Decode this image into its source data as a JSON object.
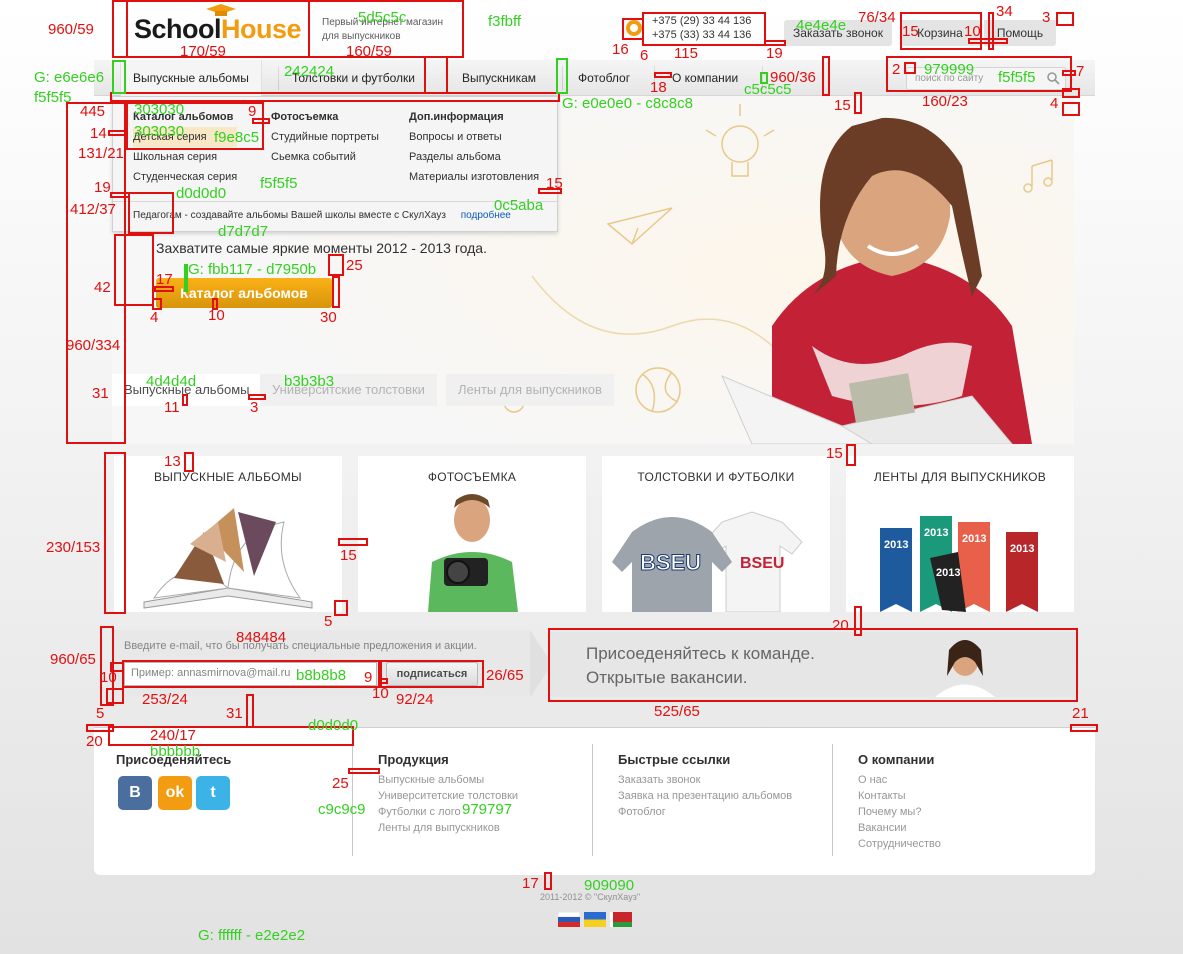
{
  "header": {
    "logo_school": "School",
    "logo_house": "House",
    "tagline_1": "Первый интернет магазин",
    "tagline_2": "для выпускников",
    "phone_1": "+375 (29) 33 44 136",
    "phone_2": "+375 (33) 33 44 136",
    "call_label": "Заказать звонок",
    "cart_label": "Корзина",
    "help_label": "Помощь"
  },
  "nav": {
    "items": [
      {
        "label": "Выпускные альбомы"
      },
      {
        "label": "Толстовки и футболки"
      },
      {
        "label": "Выпускникам"
      },
      {
        "label": "Фотоблог"
      },
      {
        "label": "О компании"
      }
    ],
    "search_placeholder": "поиск по сайту"
  },
  "dropdown": {
    "col1": {
      "head": "Каталог альбомов",
      "items": [
        "Детская серия",
        "Школьная серия",
        "Студенческая серия"
      ]
    },
    "col2": {
      "head": "Фотосъемка",
      "items": [
        "Студийные портреты",
        "Сьемка событий"
      ]
    },
    "col3": {
      "head": "Доп.информация",
      "items": [
        "Вопросы и ответы",
        "Разделы альбома",
        "Материалы изготовления"
      ]
    },
    "footer_text": "Педагогам - создавайте альбомы Вашей школы вместе с СкулХауз",
    "footer_link": "подробнее"
  },
  "hero": {
    "text": "Захватите самые яркие моменты 2012 - 2013 года.",
    "button": "Каталог альбомов",
    "tabs": [
      "Выпускные альбомы",
      "Университские толстовки",
      "Ленты для выпускников"
    ]
  },
  "categories": [
    {
      "title": "ВЫПУСКНЫЕ АЛЬБОМЫ"
    },
    {
      "title": "ФОТОСЪЕМКА"
    },
    {
      "title": "ТОЛСТОВКИ И ФУТБОЛКИ"
    },
    {
      "title": "ЛЕНТЫ ДЛЯ ВЫПУСКНИКОВ"
    }
  ],
  "shirt_print": "BSEU",
  "ribbon_year": "2013",
  "subscribe": {
    "hint": "Введите e-mail, что бы получать специальные предложения и акции.",
    "input_placeholder": "Пример: annasmirnova@mail.ru",
    "button": "подписаться"
  },
  "jobs": {
    "line_1": "Присоеденяйтесь к команде.",
    "line_2": "Открытые вакансии."
  },
  "footer": {
    "join_title": "Присоеденяйтесь",
    "social": [
      "B",
      "ok",
      "t"
    ],
    "products_title": "Продукция",
    "products": [
      "Выпускные альбомы",
      "Университетские толстовки",
      "Футболки с лого",
      "Ленты для выпускников"
    ],
    "quick_title": "Быстрые ссылки",
    "quick": [
      "Заказать звонок",
      "Заявка на презентацию альбомов",
      "Фотоблог"
    ],
    "about_title": "О компании",
    "about": [
      "О нас",
      "Контакты",
      "Почему мы?",
      "Вакансии",
      "Сотрудничество"
    ],
    "copyright": "2011-2012 ©  \"СкулХауз\""
  },
  "annotations": {
    "labels": [
      "960/59",
      "170/59",
      "160/59",
      "5d5c5c",
      "f3fbff",
      "16",
      "6",
      "115",
      "19",
      "4e4e4e",
      "76/34",
      "34",
      "3",
      "15",
      "10",
      "G: e6e6e6",
      "f5f5f5",
      "242424",
      "960/36",
      "c5c5c5",
      "18",
      "2",
      "979999",
      "f5f5f5",
      "7",
      "160/23",
      "4",
      "15",
      "G: e0e0e0 - c8c8c8",
      "445",
      "303030",
      "9",
      "14",
      "303030",
      "f9e8c5",
      "131/21",
      "19",
      "d0d0d0",
      "f5f5f5",
      "15",
      "412/37",
      "0c5aba",
      "d7d7d7",
      "17",
      "G: fbb117 - d7950b",
      "25",
      "42",
      "4",
      "10",
      "30",
      "960/334",
      "4d4d4d",
      "b3b3b3",
      "31",
      "11",
      "3",
      "13",
      "15",
      "230/153",
      "15",
      "5",
      "20",
      "960/65",
      "848484",
      "10",
      "b8b8b8",
      "9",
      "10",
      "26/65",
      "253/24",
      "92/24",
      "525/65",
      "5",
      "31",
      "d0d0d0",
      "21",
      "20",
      "240/17",
      "bbbbbb",
      "25",
      "c9c9c9",
      "979797",
      "17",
      "909090",
      "G: ffffff - e2e2e2"
    ]
  },
  "colors": {
    "accent": "#f39c12",
    "button_top": "#fbb117",
    "button_bottom": "#d7950b",
    "link": "#0c5aba",
    "annotation_red": "#e01010",
    "annotation_green": "#34d021"
  }
}
